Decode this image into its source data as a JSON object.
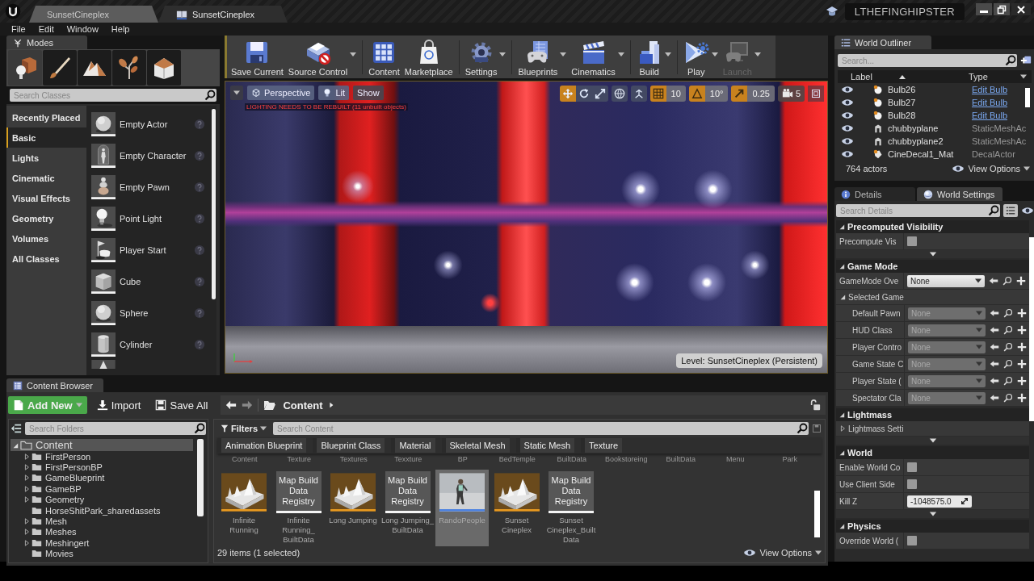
{
  "title_bar": {
    "tabs": [
      {
        "label": "SunsetCineplex",
        "kind": "plain",
        "selected": true
      },
      {
        "label": "SunsetCineplex",
        "kind": "level",
        "selected": false
      }
    ],
    "user": "LTHEFINGHIPSTER"
  },
  "menu": [
    "File",
    "Edit",
    "Window",
    "Help"
  ],
  "modes": {
    "tab": "Modes",
    "mode_buttons": [
      {
        "kind": "place",
        "selected": true
      },
      {
        "kind": "paint",
        "selected": false
      },
      {
        "kind": "landscape",
        "selected": false
      },
      {
        "kind": "foliage",
        "selected": false
      },
      {
        "kind": "geometry",
        "selected": false
      }
    ],
    "search_placeholder": "Search Classes",
    "categories": [
      {
        "label": "Recently Placed",
        "selected": false
      },
      {
        "label": "Basic",
        "selected": true
      },
      {
        "label": "Lights",
        "selected": false
      },
      {
        "label": "Cinematic",
        "selected": false
      },
      {
        "label": "Visual Effects",
        "selected": false
      },
      {
        "label": "Geometry",
        "selected": false
      },
      {
        "label": "Volumes",
        "selected": false
      },
      {
        "label": "All Classes",
        "selected": false
      }
    ],
    "items": [
      {
        "label": "Empty Actor",
        "kind": "sphere"
      },
      {
        "label": "Empty Character",
        "kind": "figure"
      },
      {
        "label": "Empty Pawn",
        "kind": "pawn"
      },
      {
        "label": "Point Light",
        "kind": "bulb"
      },
      {
        "label": "Player Start",
        "kind": "flag"
      },
      {
        "label": "Cube",
        "kind": "cube"
      },
      {
        "label": "Sphere",
        "kind": "sphere"
      },
      {
        "label": "Cylinder",
        "kind": "cylinder"
      },
      {
        "kind": "cone"
      }
    ]
  },
  "toolbar": [
    {
      "label": "Save Current",
      "kind": "save",
      "dropdown": false,
      "disabled": false,
      "separator_after": false
    },
    {
      "label": "Source Control",
      "kind": "source_control",
      "dropdown": true,
      "disabled": false,
      "separator_after": true
    },
    {
      "label": "Content",
      "kind": "content",
      "dropdown": false,
      "disabled": false,
      "separator_after": false
    },
    {
      "label": "Marketplace",
      "kind": "marketplace",
      "dropdown": false,
      "disabled": false,
      "separator_after": true
    },
    {
      "label": "Settings",
      "kind": "settings",
      "dropdown": true,
      "disabled": false,
      "separator_after": true
    },
    {
      "label": "Blueprints",
      "kind": "blueprints",
      "dropdown": true,
      "disabled": false,
      "separator_after": false
    },
    {
      "label": "Cinematics",
      "kind": "cinematics",
      "dropdown": true,
      "disabled": false,
      "separator_after": true
    },
    {
      "label": "Build",
      "kind": "build",
      "dropdown": true,
      "disabled": false,
      "separator_after": true
    },
    {
      "label": "Play",
      "kind": "play",
      "dropdown": true,
      "disabled": false,
      "separator_after": false
    },
    {
      "label": "Launch",
      "kind": "launch",
      "dropdown": true,
      "disabled": true,
      "separator_after": false
    }
  ],
  "viewport": {
    "view_buttons": [
      {
        "label": "Perspective",
        "kind": "perspective"
      },
      {
        "label": "Lit",
        "kind": "lit"
      },
      {
        "label": "Show",
        "kind": "show"
      }
    ],
    "warning": "LIGHTING NEEDS TO BE REBUILT (11 unbuilt objects)",
    "transform_modes": [
      {
        "kind": "translate",
        "selected": true
      },
      {
        "kind": "rotate",
        "selected": false
      },
      {
        "kind": "scale",
        "selected": false
      }
    ],
    "snaps": [
      {
        "kind": "grid",
        "value": "10",
        "on": true
      },
      {
        "kind": "rotation",
        "value": "10°",
        "on": true
      },
      {
        "kind": "scale",
        "value": "0.25",
        "on": true
      }
    ],
    "camera_speed": "5",
    "level": "Level: SunsetCineplex (Persistent)"
  },
  "outliner": {
    "tab": "World Outliner",
    "search_placeholder": "Search...",
    "columns": [
      "Label",
      "Type"
    ],
    "rows": [
      {
        "label": "Bulb26",
        "kind": "bulb",
        "type": "Edit Bulb",
        "link": true
      },
      {
        "label": "Bulb27",
        "kind": "bulb",
        "type": "Edit Bulb",
        "link": true
      },
      {
        "label": "Bulb28",
        "kind": "bulb",
        "type": "Edit Bulb",
        "link": true
      },
      {
        "label": "chubbyplane",
        "kind": "mesh",
        "type": "StaticMeshAc",
        "link": false
      },
      {
        "label": "chubbyplane2",
        "kind": "mesh",
        "type": "StaticMeshAc",
        "link": false
      },
      {
        "label": "CineDecal1_Mat",
        "kind": "decal",
        "type": "DecalActor",
        "link": false
      }
    ],
    "count": "764 actors",
    "view_options": "View Options"
  },
  "details": {
    "tabs": [
      {
        "label": "Details",
        "kind": "details",
        "selected": false
      },
      {
        "label": "World Settings",
        "kind": "world",
        "selected": true
      }
    ],
    "search_placeholder": "Search Details",
    "sections": [
      {
        "title": "Precomputed Visibility",
        "expanded": true,
        "advanced": true,
        "rows": [
          {
            "kind": "checkbox",
            "label": "Precompute Vis",
            "checked": false
          }
        ]
      },
      {
        "title": "Game Mode",
        "expanded": true,
        "advanced": false,
        "rows": [
          {
            "kind": "dropdown",
            "label": "GameMode Ove",
            "value": "None",
            "disabled": false
          },
          {
            "kind": "group",
            "label": "Selected Game",
            "expanded": true,
            "children": [
              {
                "kind": "dropdown",
                "label": "Default Pawn",
                "value": "None",
                "disabled": true
              },
              {
                "kind": "dropdown",
                "label": "HUD Class",
                "value": "None",
                "disabled": true
              },
              {
                "kind": "dropdown",
                "label": "Player Contro",
                "value": "None",
                "disabled": true
              },
              {
                "kind": "dropdown",
                "label": "Game State C",
                "value": "None",
                "disabled": true
              },
              {
                "kind": "dropdown",
                "label": "Player State (",
                "value": "None",
                "disabled": true
              },
              {
                "kind": "dropdown",
                "label": "Spectator Cla",
                "value": "None",
                "disabled": true
              }
            ]
          }
        ]
      },
      {
        "title": "Lightmass",
        "expanded": true,
        "advanced": true,
        "rows": [
          {
            "kind": "group",
            "label": "Lightmass Setti",
            "expanded": false
          }
        ]
      },
      {
        "title": "World",
        "expanded": true,
        "advanced": true,
        "rows": [
          {
            "kind": "checkbox",
            "label": "Enable World Co",
            "checked": false
          },
          {
            "kind": "checkbox",
            "label": "Use Client Side",
            "checked": false
          },
          {
            "kind": "number",
            "label": "Kill Z",
            "value": "-1048575.0"
          }
        ]
      },
      {
        "title": "Physics",
        "expanded": true,
        "advanced": false,
        "rows": [
          {
            "kind": "checkbox",
            "label": "Override World (",
            "checked": false
          }
        ]
      }
    ]
  },
  "content_browser": {
    "tab": "Content Browser",
    "actions": [
      {
        "label": "Add New",
        "kind": "add_new"
      },
      {
        "label": "Import",
        "kind": "import"
      },
      {
        "label": "Save All",
        "kind": "save_all"
      }
    ],
    "path": "Content",
    "folder_search_placeholder": "Search Folders",
    "folders": {
      "label": "Content",
      "expanded": true,
      "selected": true,
      "children": [
        {
          "label": "FirstPerson",
          "expandable": true,
          "selected": false
        },
        {
          "label": "FirstPersonBP",
          "expandable": true,
          "selected": false
        },
        {
          "label": "GameBlueprint",
          "expandable": true,
          "selected": false
        },
        {
          "label": "GameBP",
          "expandable": true,
          "selected": false
        },
        {
          "label": "Geometry",
          "expandable": true,
          "selected": false
        },
        {
          "label": "HorseShitPark_sharedassets",
          "expandable": false,
          "selected": false
        },
        {
          "label": "Mesh",
          "expandable": true,
          "selected": false
        },
        {
          "label": "Meshes",
          "expandable": true,
          "selected": false
        },
        {
          "label": "Meshingert",
          "expandable": true,
          "selected": false
        },
        {
          "label": "Movies",
          "expandable": false,
          "selected": false
        }
      ]
    },
    "filters": "Filters",
    "search_placeholder": "Search Content",
    "filter_chips": [
      "Animation Blueprint",
      "Blueprint Class",
      "Material",
      "Skeletal Mesh",
      "Static Mesh",
      "Texture"
    ],
    "partial_row_labels": [
      "Content",
      "Texture",
      "Textures",
      "Texxture",
      "BP",
      "BedTemple",
      "BuiltData",
      "Bookstoreing",
      "BuiltData",
      "Menu",
      "Park"
    ],
    "assets": [
      {
        "name": "Infinite Running",
        "kind": "level",
        "selected": false
      },
      {
        "name": "Infinite Running_ BuiltData",
        "kind": "build_data",
        "thumb_text": "Map Build Data Registry",
        "selected": false
      },
      {
        "name": "Long Jumping",
        "kind": "level",
        "selected": false
      },
      {
        "name": "Long Jumping_ BuiltData",
        "kind": "build_data",
        "thumb_text": "Map Build Data Registry",
        "selected": false
      },
      {
        "name": "RandoPeople",
        "kind": "character",
        "selected": true
      },
      {
        "name": "Sunset Cineplex",
        "kind": "level",
        "selected": false
      },
      {
        "name": "Sunset Cineplex_Built Data",
        "kind": "build_data",
        "thumb_text": "Map Build Data Registry",
        "selected": false
      }
    ],
    "status": "29 items (1 selected)",
    "view_options": "View Options"
  }
}
